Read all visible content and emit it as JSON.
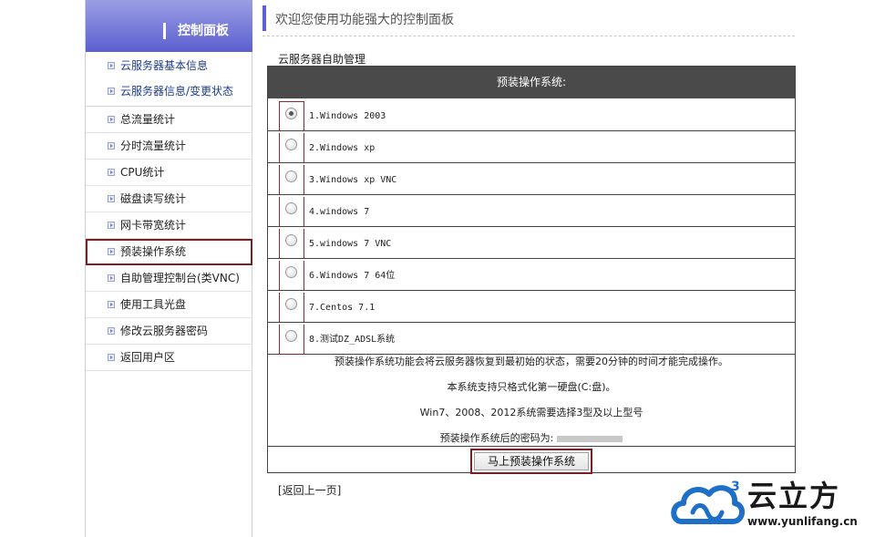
{
  "sidebar": {
    "title": "控制面板",
    "group1": [
      {
        "label": "云服务器基本信息"
      },
      {
        "label": "云服务器信息/变更状态"
      }
    ],
    "group2": [
      {
        "label": "总流量统计"
      },
      {
        "label": "分时流量统计"
      },
      {
        "label": "CPU统计"
      },
      {
        "label": "磁盘读写统计"
      },
      {
        "label": "网卡带宽统计"
      },
      {
        "label": "预装操作系统"
      },
      {
        "label": "自助管理控制台(类VNC)"
      },
      {
        "label": "使用工具光盘"
      },
      {
        "label": "修改云服务器密码"
      },
      {
        "label": "返回用户区"
      }
    ],
    "active_item": "预装操作系统"
  },
  "header": {
    "welcome": "欢迎您使用功能强大的控制面板"
  },
  "main": {
    "section_title": "云服务器自助管理",
    "table_header": "预装操作系统:",
    "options": [
      {
        "label": "1.Windows 2003",
        "checked": true
      },
      {
        "label": "2.Windows xp",
        "checked": false
      },
      {
        "label": "3.Windows xp VNC",
        "checked": false
      },
      {
        "label": "4.windows 7",
        "checked": false
      },
      {
        "label": "5.windows 7 VNC",
        "checked": false
      },
      {
        "label": "6.Windows 7 64位",
        "checked": false
      },
      {
        "label": "7.Centos 7.1",
        "checked": false
      },
      {
        "label": "8.测试DZ_ADSL系统",
        "checked": false
      }
    ],
    "info_lines": [
      "预装操作系统功能会将云服务器恢复到最初始的状态，需要20分钟的时间才能完成操作。",
      "本系统支持只格式化第一硬盘(C:盘)。",
      "Win7、2008、2012系统需要选择3型及以上型号"
    ],
    "password_label": "预装操作系统后的密码为:",
    "submit_label": "马上预装操作系统",
    "back_link": "[返回上一页]"
  },
  "logo": {
    "brand": "云立方",
    "url": "www.yunlifang.cn",
    "superscript": "3",
    "color": "#1e6fc8"
  }
}
